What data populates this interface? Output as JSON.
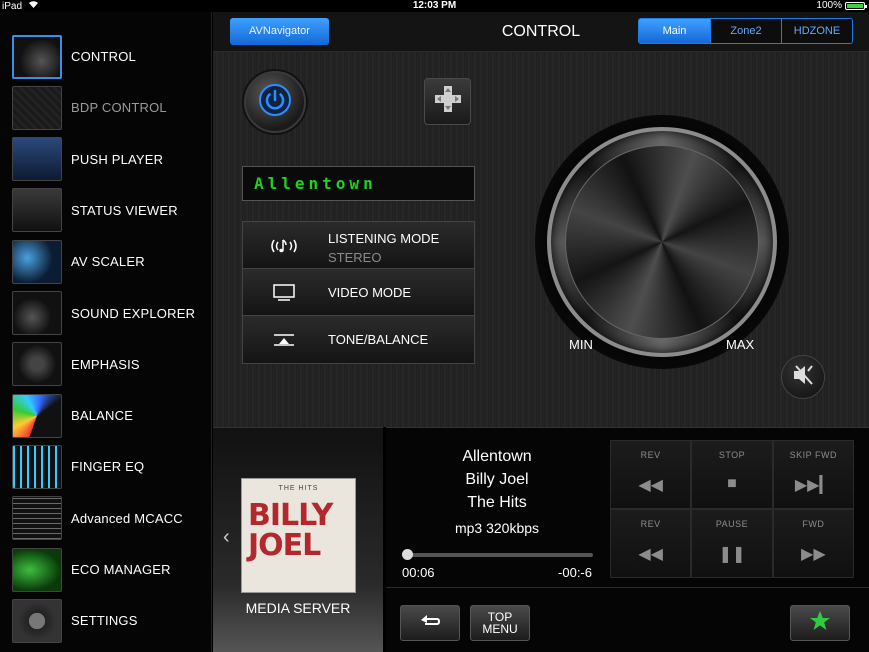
{
  "status_bar": {
    "device": "iPad",
    "time": "12:03 PM",
    "battery": "100%",
    "battery_level": 1.0
  },
  "sidebar": {
    "items": [
      {
        "label": "CONTROL",
        "icon": "control-thumb-icon"
      },
      {
        "label": "BDP CONTROL",
        "icon": "bdp-control-thumb-icon"
      },
      {
        "label": "PUSH PLAYER",
        "icon": "push-player-thumb-icon"
      },
      {
        "label": "STATUS VIEWER",
        "icon": "status-viewer-thumb-icon"
      },
      {
        "label": "AV SCALER",
        "icon": "av-scaler-thumb-icon"
      },
      {
        "label": "SOUND EXPLORER",
        "icon": "sound-explorer-thumb-icon"
      },
      {
        "label": "EMPHASIS",
        "icon": "emphasis-thumb-icon"
      },
      {
        "label": "BALANCE",
        "icon": "balance-thumb-icon"
      },
      {
        "label": "FINGER EQ",
        "icon": "finger-eq-thumb-icon"
      },
      {
        "label": "Advanced MCACC",
        "icon": "advanced-mcacc-thumb-icon"
      },
      {
        "label": "ECO MANAGER",
        "icon": "eco-manager-thumb-icon"
      },
      {
        "label": "SETTINGS",
        "icon": "settings-thumb-icon"
      }
    ],
    "active": "CONTROL",
    "dimmed": "BDP CONTROL"
  },
  "header": {
    "navigator_button": "AVNavigator",
    "title": "CONTROL",
    "zones": [
      "Main",
      "Zone2",
      "HDZONE"
    ],
    "active_zone": "Main"
  },
  "control": {
    "display_text": "Allentown",
    "modes": [
      {
        "label": "LISTENING MODE",
        "sub": "STEREO",
        "icon": "listening-mode-icon"
      },
      {
        "label": "VIDEO MODE",
        "sub": "",
        "icon": "video-mode-icon"
      },
      {
        "label": "TONE/BALANCE",
        "sub": "",
        "icon": "tone-balance-icon"
      }
    ],
    "volume": {
      "min_label": "MIN",
      "max_label": "MAX"
    }
  },
  "media": {
    "source_label": "MEDIA SERVER",
    "album_art_text": {
      "series": "THE HITS",
      "line1": "BILLY",
      "line2": "JOEL"
    }
  },
  "now_playing": {
    "title": "Allentown",
    "artist": "Billy Joel",
    "album": "The Hits",
    "format": "mp3 320kbps",
    "elapsed": "00:06",
    "remaining": "-00:-6",
    "progress": 0.0
  },
  "transport": {
    "buttons": [
      {
        "label": "REV",
        "symbol": "◀◀"
      },
      {
        "label": "STOP",
        "symbol": "■"
      },
      {
        "label": "SKIP FWD",
        "symbol": "▶▶▎"
      },
      {
        "label": "REV",
        "symbol": "◀◀"
      },
      {
        "label": "PAUSE",
        "symbol": "❚❚"
      },
      {
        "label": "FWD",
        "symbol": "▶▶"
      }
    ]
  },
  "bottom_bar": {
    "top_menu_line1": "TOP",
    "top_menu_line2": "MENU"
  },
  "colors": {
    "accent_blue": "#1f7de8",
    "display_green": "#1ed21e",
    "favorite_green": "#2ecc40",
    "power_blue": "#2f8cff"
  }
}
